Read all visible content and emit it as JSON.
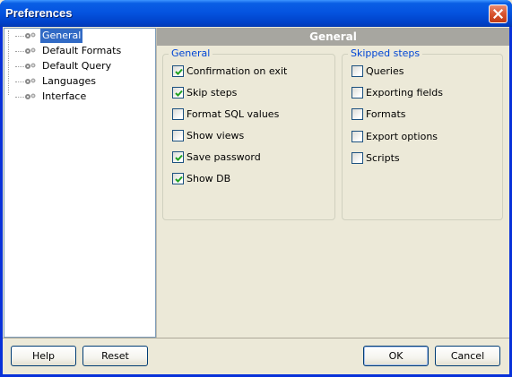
{
  "window": {
    "title": "Preferences"
  },
  "tree": {
    "items": [
      {
        "label": "General",
        "selected": true
      },
      {
        "label": "Default Formats",
        "selected": false
      },
      {
        "label": "Default Query",
        "selected": false
      },
      {
        "label": "Languages",
        "selected": false
      },
      {
        "label": "Interface",
        "selected": false
      }
    ],
    "icon": "settings-gears-icon"
  },
  "panel": {
    "header": "General",
    "general_group": {
      "title": "General",
      "options": [
        {
          "label": "Confirmation on exit",
          "checked": true
        },
        {
          "label": "Skip steps",
          "checked": true
        },
        {
          "label": "Format SQL values",
          "checked": false
        },
        {
          "label": "Show views",
          "checked": false
        },
        {
          "label": "Save password",
          "checked": true
        },
        {
          "label": "Show DB",
          "checked": true
        }
      ]
    },
    "skipped_group": {
      "title": "Skipped steps",
      "options": [
        {
          "label": "Queries",
          "checked": false
        },
        {
          "label": "Exporting fields",
          "checked": false
        },
        {
          "label": "Formats",
          "checked": false
        },
        {
          "label": "Export options",
          "checked": false
        },
        {
          "label": "Scripts",
          "checked": false
        }
      ]
    }
  },
  "buttons": {
    "help": "Help",
    "reset": "Reset",
    "ok": "OK",
    "cancel": "Cancel"
  },
  "colors": {
    "titlebar": "#0554e0",
    "selection": "#316ac5",
    "group_title": "#0046d5",
    "panel_header": "#a7a6a0"
  }
}
